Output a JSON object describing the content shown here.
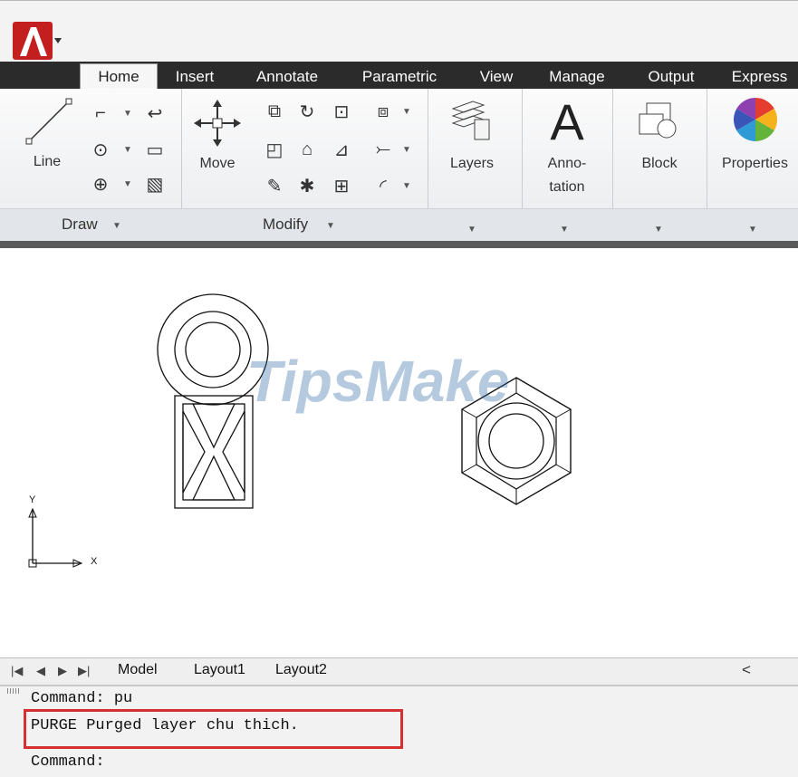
{
  "tabs": [
    "Home",
    "Insert",
    "Annotate",
    "Parametric",
    "View",
    "Manage",
    "Output",
    "Express"
  ],
  "ribbon": {
    "draw_title": "Draw",
    "modify_title": "Modify",
    "line_label": "Line",
    "move_label": "Move",
    "layers_label": "Layers",
    "annotation_label_1": "Anno-",
    "annotation_label_2": "tation",
    "annotation_glyph": "A",
    "block_label": "Block",
    "properties_label": "Properties"
  },
  "ucs": {
    "y_label": "Y",
    "x_label": "X"
  },
  "watermark": "TipsMake",
  "layout_tabs": [
    "Model",
    "Layout1",
    "Layout2"
  ],
  "command": {
    "line1": "Command: pu",
    "line2": "PURGE Purged layer chu thich.",
    "line3": "Command:"
  },
  "colors": {
    "highlight": "#d53030",
    "tab_bg": "#2b2b2b"
  },
  "icons": [
    "autocad-logo-icon",
    "line-icon",
    "polyline-icon",
    "circle-icon",
    "arc-icon",
    "rectangle-icon",
    "hatch-icon",
    "move-icon",
    "copy-icon",
    "rotate-icon",
    "stretch-icon",
    "mirror-icon",
    "fillet-icon",
    "array-icon",
    "trim-icon",
    "scale-icon",
    "layers-icon",
    "block-icon",
    "color-wheel-icon"
  ]
}
